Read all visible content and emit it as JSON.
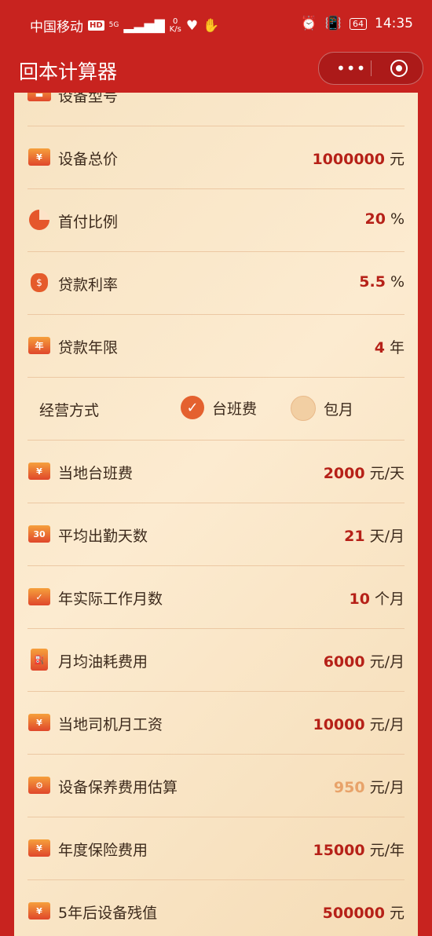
{
  "status": {
    "carrier": "中国移动",
    "hd": "HD",
    "network": "5G",
    "speed_value": "0",
    "speed_unit": "K/s",
    "battery": "64",
    "time": "14:35"
  },
  "app": {
    "title": "回本计算器",
    "more_label": "•••"
  },
  "form": {
    "rows": [
      {
        "label": "设备型号",
        "value": "",
        "unit": "",
        "icon": "truck-icon"
      },
      {
        "label": "设备总价",
        "value": "1000000",
        "unit": "元",
        "icon": "price-tag-icon"
      },
      {
        "label": "首付比例",
        "value": "20",
        "unit": "%",
        "icon": "pie-chart-icon"
      },
      {
        "label": "贷款利率",
        "value": "5.5",
        "unit": "%",
        "icon": "money-bag-icon"
      },
      {
        "label": "贷款年限",
        "value": "4",
        "unit": "年",
        "icon": "calendar-year-icon",
        "icon_text": "年"
      },
      {
        "label": "当地台班费",
        "value": "2000",
        "unit": "元/天",
        "icon": "yuan-card-icon",
        "icon_text": "¥"
      },
      {
        "label": "平均出勤天数",
        "value": "21",
        "unit": "天/月",
        "icon": "calendar-30-icon",
        "icon_text": "30"
      },
      {
        "label": "年实际工作月数",
        "value": "10",
        "unit": "个月",
        "icon": "calendar-check-icon",
        "icon_text": "✓"
      },
      {
        "label": "月均油耗费用",
        "value": "6000",
        "unit": "元/月",
        "icon": "fuel-pump-icon",
        "icon_text": "⛽"
      },
      {
        "label": "当地司机月工资",
        "value": "10000",
        "unit": "元/月",
        "icon": "wage-card-icon",
        "icon_text": "¥"
      },
      {
        "label": "设备保养费用估算",
        "value": "950",
        "unit": "元/月",
        "icon": "maintenance-icon",
        "icon_text": "⚙"
      },
      {
        "label": "年度保险费用",
        "value": "15000",
        "unit": "元/年",
        "icon": "insurance-icon",
        "icon_text": "¥"
      },
      {
        "label": "5年后设备残值",
        "value": "500000",
        "unit": "元",
        "icon": "residual-truck-icon",
        "icon_text": "¥"
      }
    ],
    "operation_mode": {
      "label": "经营方式",
      "option_1": "台班费",
      "option_2": "包月",
      "selected": "台班费"
    }
  }
}
